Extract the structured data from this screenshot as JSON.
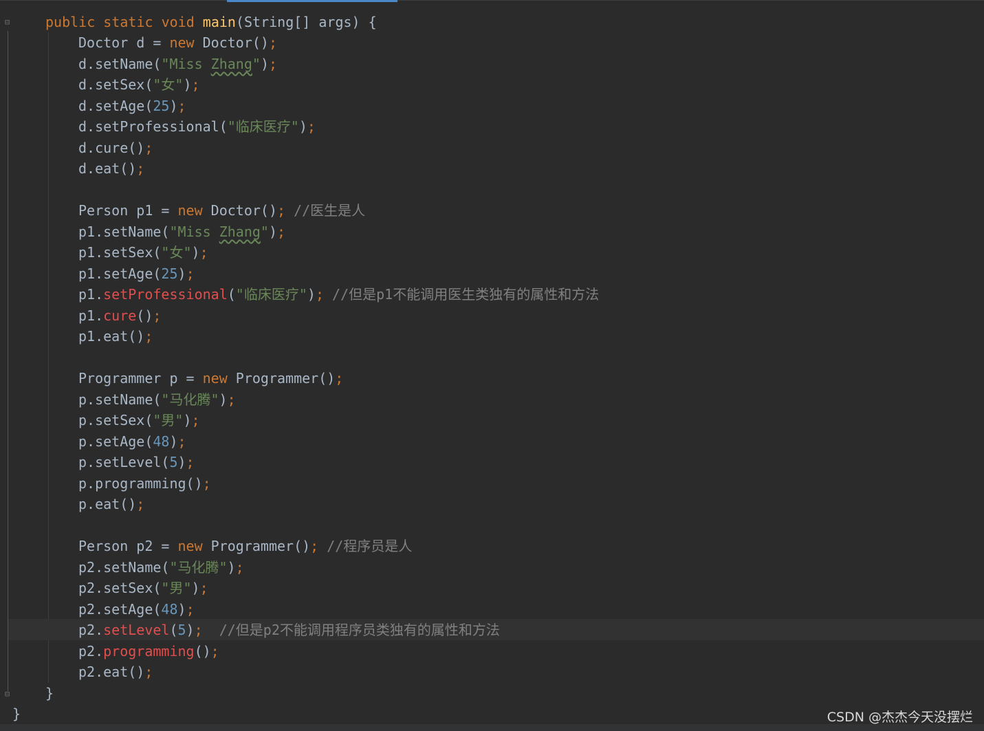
{
  "code": {
    "main_sig": {
      "p1": "public static void ",
      "name": "main",
      "p2": "(String[] args) {"
    },
    "lines": {
      "d1": {
        "a": "Doctor d = ",
        "kw": "new",
        "b": " Doctor()",
        "p": ";"
      },
      "d2": {
        "a": "d.setName(",
        "s1": "\"Miss ",
        "s2": "Zhang",
        "s3": "\"",
        "b": ")",
        "p": ";"
      },
      "d3": {
        "a": "d.setSex(",
        "s": "\"女\"",
        "b": ")",
        "p": ";"
      },
      "d4": {
        "a": "d.setAge(",
        "n": "25",
        "b": ")",
        "p": ";"
      },
      "d5": {
        "a": "d.setProfessional(",
        "s": "\"临床医疗\"",
        "b": ")",
        "p": ";"
      },
      "d6": {
        "a": "d.cure()",
        "p": ";"
      },
      "d7": {
        "a": "d.eat()",
        "p": ";"
      },
      "p1_1": {
        "a": "Person p1 = ",
        "kw": "new",
        "b": " Doctor()",
        "p": "; ",
        "c": "//医生是人"
      },
      "p1_2": {
        "a": "p1.setName(",
        "s1": "\"Miss ",
        "s2": "Zhang",
        "s3": "\"",
        "b": ")",
        "p": ";"
      },
      "p1_3": {
        "a": "p1.setSex(",
        "s": "\"女\"",
        "b": ")",
        "p": ";"
      },
      "p1_4": {
        "a": "p1.setAge(",
        "n": "25",
        "b": ")",
        "p": ";"
      },
      "p1_5": {
        "a": "p1.",
        "e": "setProfessional",
        "b": "(",
        "s": "\"临床医疗\"",
        "b2": ")",
        "p": "; ",
        "c": "//但是p1不能调用医生类独有的属性和方法"
      },
      "p1_6": {
        "a": "p1.",
        "e": "cure",
        "b": "()",
        "p": ";"
      },
      "p1_7": {
        "a": "p1.eat()",
        "p": ";"
      },
      "pr1": {
        "a": "Programmer p = ",
        "kw": "new",
        "b": " Programmer()",
        "p": ";"
      },
      "pr2": {
        "a": "p.setName(",
        "s": "\"马化腾\"",
        "b": ")",
        "p": ";"
      },
      "pr3": {
        "a": "p.setSex(",
        "s": "\"男\"",
        "b": ")",
        "p": ";"
      },
      "pr4": {
        "a": "p.setAge(",
        "n": "48",
        "b": ")",
        "p": ";"
      },
      "pr5": {
        "a": "p.setLevel(",
        "n": "5",
        "b": ")",
        "p": ";"
      },
      "pr6": {
        "a": "p.programming()",
        "p": ";"
      },
      "pr7": {
        "a": "p.eat()",
        "p": ";"
      },
      "p2_1": {
        "a": "Person p2 = ",
        "kw": "new",
        "b": " Programmer()",
        "p": "; ",
        "c": "//程序员是人"
      },
      "p2_2": {
        "a": "p2.setName(",
        "s": "\"马化腾\"",
        "b": ")",
        "p": ";"
      },
      "p2_3": {
        "a": "p2.setSex(",
        "s": "\"男\"",
        "b": ")",
        "p": ";"
      },
      "p2_4": {
        "a": "p2.setAge(",
        "n": "48",
        "b": ")",
        "p": ";"
      },
      "p2_5": {
        "a": "p2.",
        "e": "setLevel",
        "b": "(",
        "n": "5",
        "b2": ")",
        "p": ";  ",
        "c": "//但是p2不能调用程序员类独有的属性和方法"
      },
      "p2_6": {
        "a": "p2.",
        "e": "programming",
        "b": "()",
        "p": ";"
      },
      "p2_7": {
        "a": "p2.eat()",
        "p": ";"
      }
    },
    "close_method": "}",
    "close_class": "}"
  },
  "watermark": "CSDN @杰杰今天没摆烂",
  "colors": {
    "background": "#2b2b2b",
    "keyword": "#cc7832",
    "method_decl": "#ffc66d",
    "string": "#6a8759",
    "number": "#6897bb",
    "comment": "#808080",
    "error": "#e14e4e",
    "text": "#a9b7c6"
  }
}
